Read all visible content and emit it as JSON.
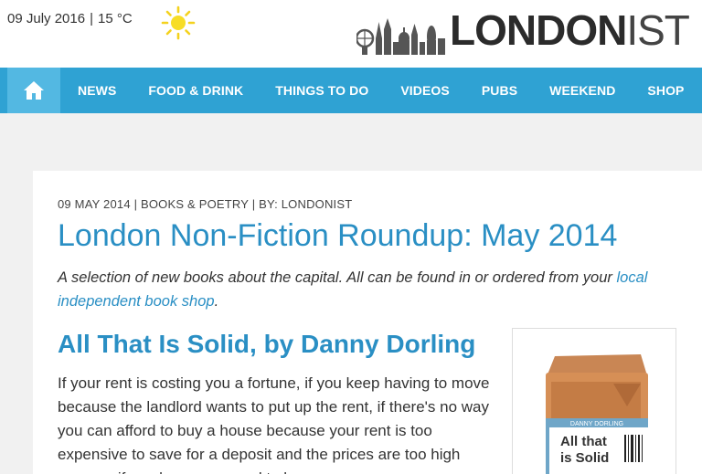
{
  "header": {
    "date": "09 July 2016",
    "separator": "|",
    "temperature": "15 °C",
    "weather_icon": "sun-icon",
    "logo_text_main": "LONDON",
    "logo_text_end": "IST"
  },
  "nav": {
    "home_icon": "home-icon",
    "items": [
      "NEWS",
      "FOOD & DRINK",
      "THINGS TO DO",
      "VIDEOS",
      "PUBS",
      "WEEKEND",
      "SHOP"
    ]
  },
  "article": {
    "meta": "09 MAY 2014 | BOOKS & POETRY | BY: LONDONIST",
    "title": "London Non-Fiction Roundup: May 2014",
    "standfirst_text": "A selection of new books about the capital. All can be found in or ordered from your",
    "standfirst_link": "local independent book shop",
    "standfirst_end": ".",
    "section_title": "All That Is Solid, by Danny Dorling",
    "body": "If your rent is costing you a fortune, if you keep having to move because the landlord wants to put up the rent, if there's no way you can afford to buy a house because your rent is too expensive to save for a deposit and the prices are too high anyway, if you have managed to buy",
    "book_cover": {
      "author": "DANNY DORLING",
      "title_line1": "All that",
      "title_line2": "is Solid"
    }
  },
  "colors": {
    "nav_bg": "#2fa2d3",
    "nav_home_bg": "#53b8e2",
    "title_blue": "#2a8fc4",
    "page_bg": "#f1f1f1"
  }
}
